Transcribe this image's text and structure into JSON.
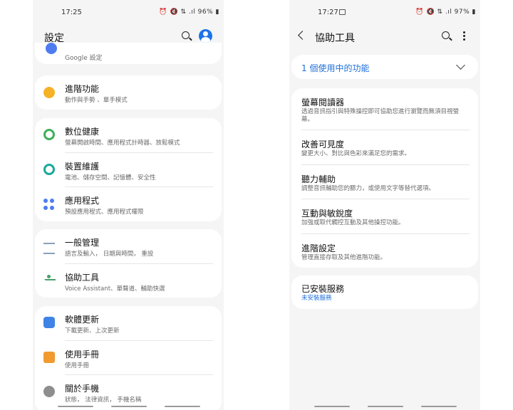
{
  "left": {
    "status": {
      "time": "17:25",
      "icons": "⏰ 🔇 ⇅ .ıl 96% ▮"
    },
    "title": "設定",
    "top_partial": {
      "subtitle": "Google 設定"
    },
    "groups": [
      {
        "items": [
          {
            "title": "進階功能",
            "subtitle": "動作與手勢 、單手模式"
          }
        ]
      },
      {
        "items": [
          {
            "title": "數位健康",
            "subtitle": "螢幕開啟時間、應用程式計時器、放鬆模式"
          },
          {
            "title": "裝置維護",
            "subtitle": "電池、儲存空間、記憶體、安全性"
          },
          {
            "title": "應用程式",
            "subtitle": "預設應用程式、應用程式權限"
          }
        ]
      },
      {
        "items": [
          {
            "title": "一般管理",
            "subtitle": "語言及輸入， 日期與時間， 重設"
          },
          {
            "title": "協助工具",
            "subtitle": "Voice Assistant、單聲道、輔助快選"
          }
        ]
      },
      {
        "items": [
          {
            "title": "軟體更新",
            "subtitle": "下載更新、上次更新"
          },
          {
            "title": "使用手冊",
            "subtitle": "使用手冊"
          },
          {
            "title": "關於手機",
            "subtitle": "狀態， 法律資訊， 手機名稱"
          }
        ]
      }
    ]
  },
  "right": {
    "status": {
      "time": "17:27",
      "icons": "⏰ 🔇 ⇅ .ıl 97% ▮"
    },
    "title": "協助工具",
    "in_use": "1 個使用中的功能",
    "items": [
      {
        "title": "螢幕閱讀器",
        "subtitle": "透過音訊指引與特殊操控即可協助您進行瀏覽而無須目視螢幕。"
      },
      {
        "title": "改善可見度",
        "subtitle": "變更大小、對比與色彩來滿足您的需求。"
      },
      {
        "title": "聽力輔助",
        "subtitle": "調整音訊輔助您的聽力，或使用文字等替代選項。"
      },
      {
        "title": "互動與敏銳度",
        "subtitle": "加強或取代觸控互動及其他操控功能。"
      },
      {
        "title": "進階設定",
        "subtitle": "管理直接存取及其他進階功能。"
      }
    ],
    "installed": {
      "title": "已安裝服務",
      "subtitle": "未安裝服務",
      "subtitle_color": "#1e6fd9"
    }
  },
  "colors": {
    "accent": "#1e73e8",
    "link": "#1e6fd9"
  }
}
